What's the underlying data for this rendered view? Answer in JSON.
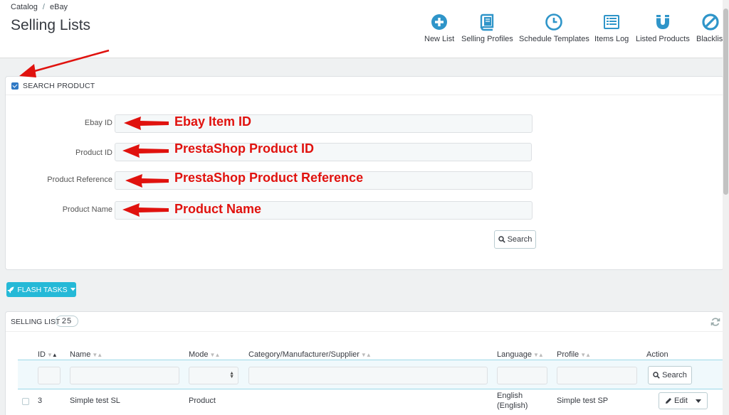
{
  "breadcrumb": {
    "items": [
      "Catalog",
      "eBay"
    ]
  },
  "page_title": "Selling Lists",
  "toolbar": {
    "buttons": [
      {
        "label": "New List",
        "icon": "plus-circle-icon"
      },
      {
        "label": "Selling Profiles",
        "icon": "book-icon"
      },
      {
        "label": "Schedule Templates",
        "icon": "clock-icon"
      },
      {
        "label": "Items Log",
        "icon": "list-icon"
      },
      {
        "label": "Listed Products",
        "icon": "magnet-icon"
      },
      {
        "label": "Blacklist",
        "icon": "ban-icon"
      }
    ]
  },
  "search_panel": {
    "title": "SEARCH PRODUCT",
    "fields": [
      {
        "label": "Ebay ID",
        "annotation": "Ebay Item ID"
      },
      {
        "label": "Product ID",
        "annotation": "PrestaShop Product ID"
      },
      {
        "label": "Product Reference",
        "annotation": "PrestaShop Product Reference"
      },
      {
        "label": "Product Name",
        "annotation": "Product Name"
      }
    ],
    "search_label": "Search"
  },
  "flash_tasks_label": "FLASH TASKS",
  "selling_list": {
    "title": "SELLING LIST",
    "count": "25",
    "columns": [
      "ID",
      "Name",
      "Mode",
      "Category/Manufacturer/Supplier",
      "Language",
      "Profile",
      "Action"
    ],
    "filter_search_label": "Search",
    "rows": [
      {
        "id": "3",
        "name": "Simple test SL",
        "mode": "Product",
        "category": "",
        "language_line1": "English",
        "language_line2": "(English)",
        "profile": "Simple test SP",
        "action": "Edit"
      }
    ]
  },
  "colors": {
    "accent": "#25b9d7",
    "icon_blue": "#2f95c9",
    "annotation_red": "#e0120e"
  }
}
